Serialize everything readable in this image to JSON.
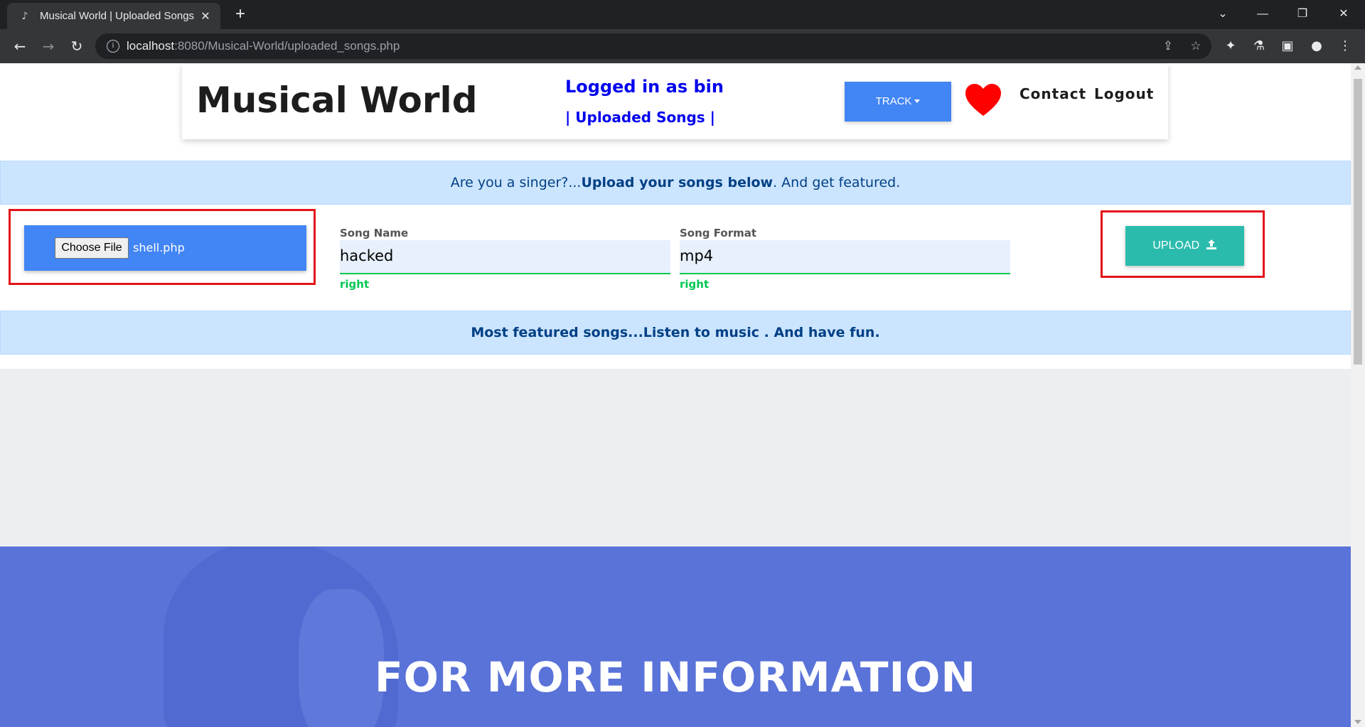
{
  "browser": {
    "tab_title": "Musical World | Uploaded Songs",
    "url_host": "localhost",
    "url_path": ":8080/Musical-World/uploaded_songs.php"
  },
  "header": {
    "brand": "Musical World",
    "logged_in": "Logged in as bin",
    "uploaded_link": "| Uploaded Songs |",
    "track_label": "TRACK",
    "contact_label": "Contact",
    "logout_label": "Logout"
  },
  "banner": {
    "prefix": "Are you a singer?...",
    "bold": "Upload your songs below",
    "suffix": ". And get featured."
  },
  "upload_form": {
    "choose_file_label": "Choose File",
    "file_name": "shell.php",
    "song_name_label": "Song Name",
    "song_name_value": "hacked",
    "song_name_valid": "right",
    "song_format_label": "Song Format",
    "song_format_value": "mp4",
    "song_format_valid": "right",
    "upload_label": "UPLOAD"
  },
  "featured": {
    "bold": "Most featured songs...Listen to music",
    "suffix": " . And have fun."
  },
  "info": {
    "title": "FOR MORE INFORMATION"
  },
  "colors": {
    "primary": "#4285f4",
    "upload": "#2bbbad",
    "alert_bg": "#cce5ff",
    "alert_text": "#004085",
    "valid": "#00c851",
    "highlight": "#e3141b",
    "info_bg": "#5a73d9"
  }
}
